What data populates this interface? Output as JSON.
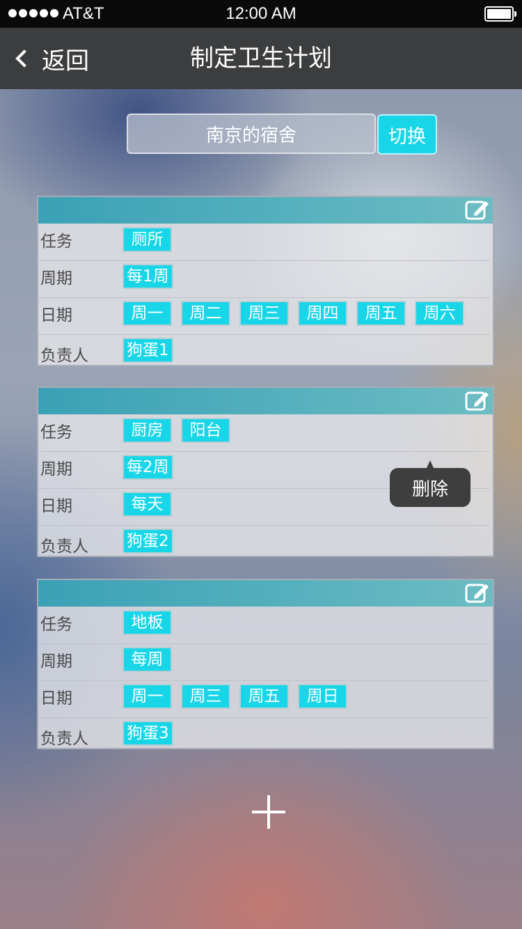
{
  "status_bar": {
    "carrier": "AT&T",
    "time": "12:00 AM"
  },
  "nav": {
    "back_label": "返回",
    "title": "制定卫生计划"
  },
  "dorm": {
    "name": "南京的宿舍",
    "switch_label": "切换"
  },
  "labels": {
    "task": "任务",
    "cycle": "周期",
    "date": "日期",
    "owner": "负责人"
  },
  "plans": [
    {
      "tasks": [
        "厕所"
      ],
      "cycle": "每1周",
      "dates": [
        "周一",
        "周二",
        "周三",
        "周四",
        "周五",
        "周六"
      ],
      "owner": "狗蛋1"
    },
    {
      "tasks": [
        "厨房",
        "阳台"
      ],
      "cycle": "每2周",
      "dates": [
        "每天"
      ],
      "owner": "狗蛋2"
    },
    {
      "tasks": [
        "地板"
      ],
      "cycle": "每周",
      "dates": [
        "周一",
        "周三",
        "周五",
        "周日"
      ],
      "owner": "狗蛋3"
    }
  ],
  "delete_popup": {
    "label": "删除"
  },
  "icons": {
    "back": "chevron-left-icon",
    "edit": "edit-icon",
    "add": "plus-icon"
  },
  "colors": {
    "chip": "#18d6e8",
    "header": "#3aa1b6",
    "nav": "#3c3d3e"
  }
}
